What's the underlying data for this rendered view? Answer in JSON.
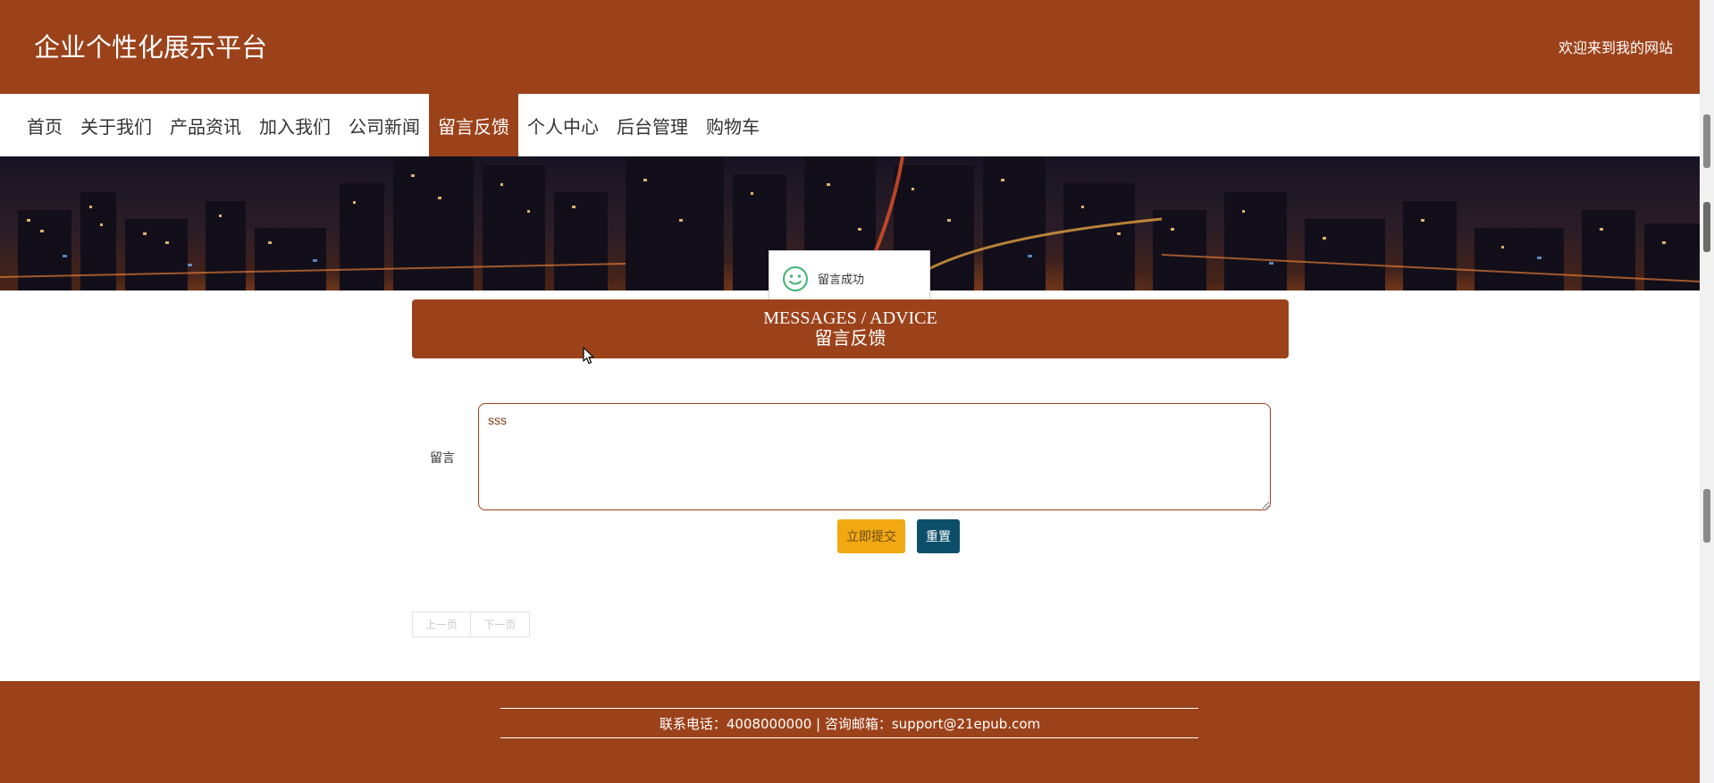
{
  "header": {
    "site_title": "企业个性化展示平台",
    "welcome": "欢迎来到我的网站"
  },
  "nav": {
    "items": [
      {
        "label": "首页",
        "active": false
      },
      {
        "label": "关于我们",
        "active": false
      },
      {
        "label": "产品资讯",
        "active": false
      },
      {
        "label": "加入我们",
        "active": false
      },
      {
        "label": "公司新闻",
        "active": false
      },
      {
        "label": "留言反馈",
        "active": true
      },
      {
        "label": "个人中心",
        "active": false
      },
      {
        "label": "后台管理",
        "active": false
      },
      {
        "label": "购物车",
        "active": false
      }
    ]
  },
  "toast": {
    "message": "留言成功",
    "icon": "smile-icon"
  },
  "section": {
    "title_en": "MESSAGES / ADVICE",
    "title_zh": "留言反馈"
  },
  "form": {
    "label": "留言",
    "textarea_value": "sss",
    "submit_label": "立即提交",
    "reset_label": "重置"
  },
  "pager": {
    "prev_label": "上一页",
    "next_label": "下一页"
  },
  "footer": {
    "contact": "联系电话：4008000000 | 咨询邮箱：support@21epub.com"
  },
  "colors": {
    "brand": "#9c421a",
    "submit": "#f2a911",
    "reset": "#0d4f6b",
    "toast_icon": "#3cb371"
  }
}
